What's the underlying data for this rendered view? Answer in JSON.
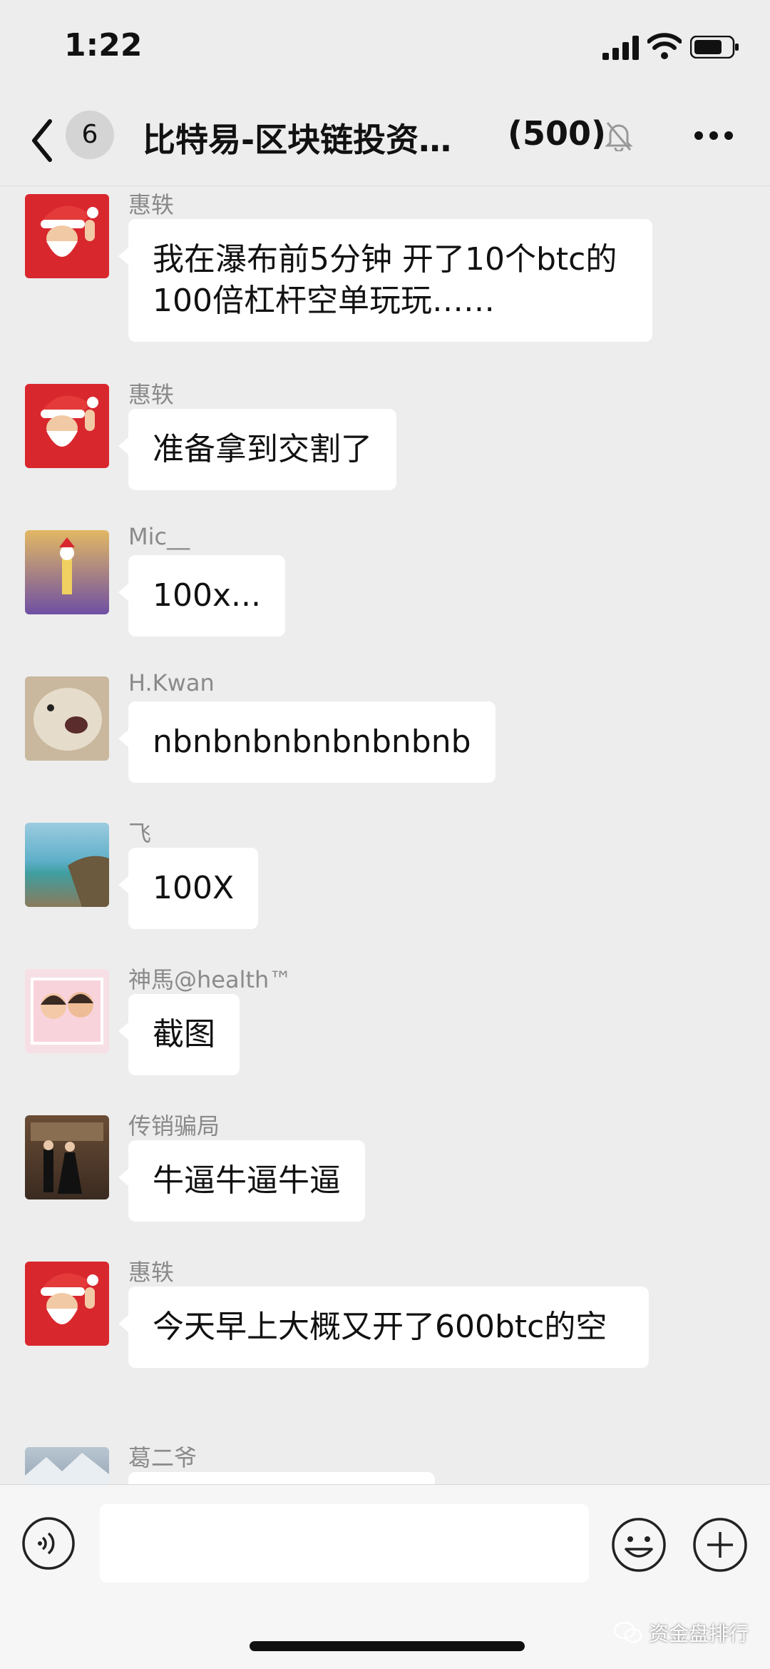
{
  "status_bar": {
    "time": "1:22"
  },
  "nav": {
    "unread_count": "6",
    "title": "比特易-区块链投资…",
    "member_count": "(500)"
  },
  "messages": [
    {
      "sender": "惠轶",
      "text": "我在瀑布前5分钟 开了10个btc的100倍杠杆空单玩玩……",
      "avatar": "santa-avatar"
    },
    {
      "sender": "惠轶",
      "text": "准备拿到交割了",
      "avatar": "santa-avatar"
    },
    {
      "sender": "Mic__",
      "text": "100x...",
      "avatar": "cartoon-avatar"
    },
    {
      "sender": "H.Kwan",
      "text": "nbnbnbnbnbnbnbnb",
      "avatar": "dog-avatar"
    },
    {
      "sender": "飞",
      "text": "100X",
      "avatar": "beach-avatar"
    },
    {
      "sender": "神馬@health™",
      "text": "截图",
      "avatar": "kids-avatar"
    },
    {
      "sender": "传销骗局",
      "text": "牛逼牛逼牛逼",
      "avatar": "couple-avatar"
    },
    {
      "sender": "惠轶",
      "text": "今天早上大概又开了600btc的空",
      "avatar": "santa-avatar"
    },
    {
      "sender": "葛二爷",
      "text": "",
      "avatar": "mountain-avatar"
    }
  ],
  "watermark": {
    "text": "资金盘排行"
  },
  "colors": {
    "background": "#ededed",
    "bubble": "#ffffff",
    "sender": "#8a8a8a",
    "santa_red": "#d9272e"
  }
}
